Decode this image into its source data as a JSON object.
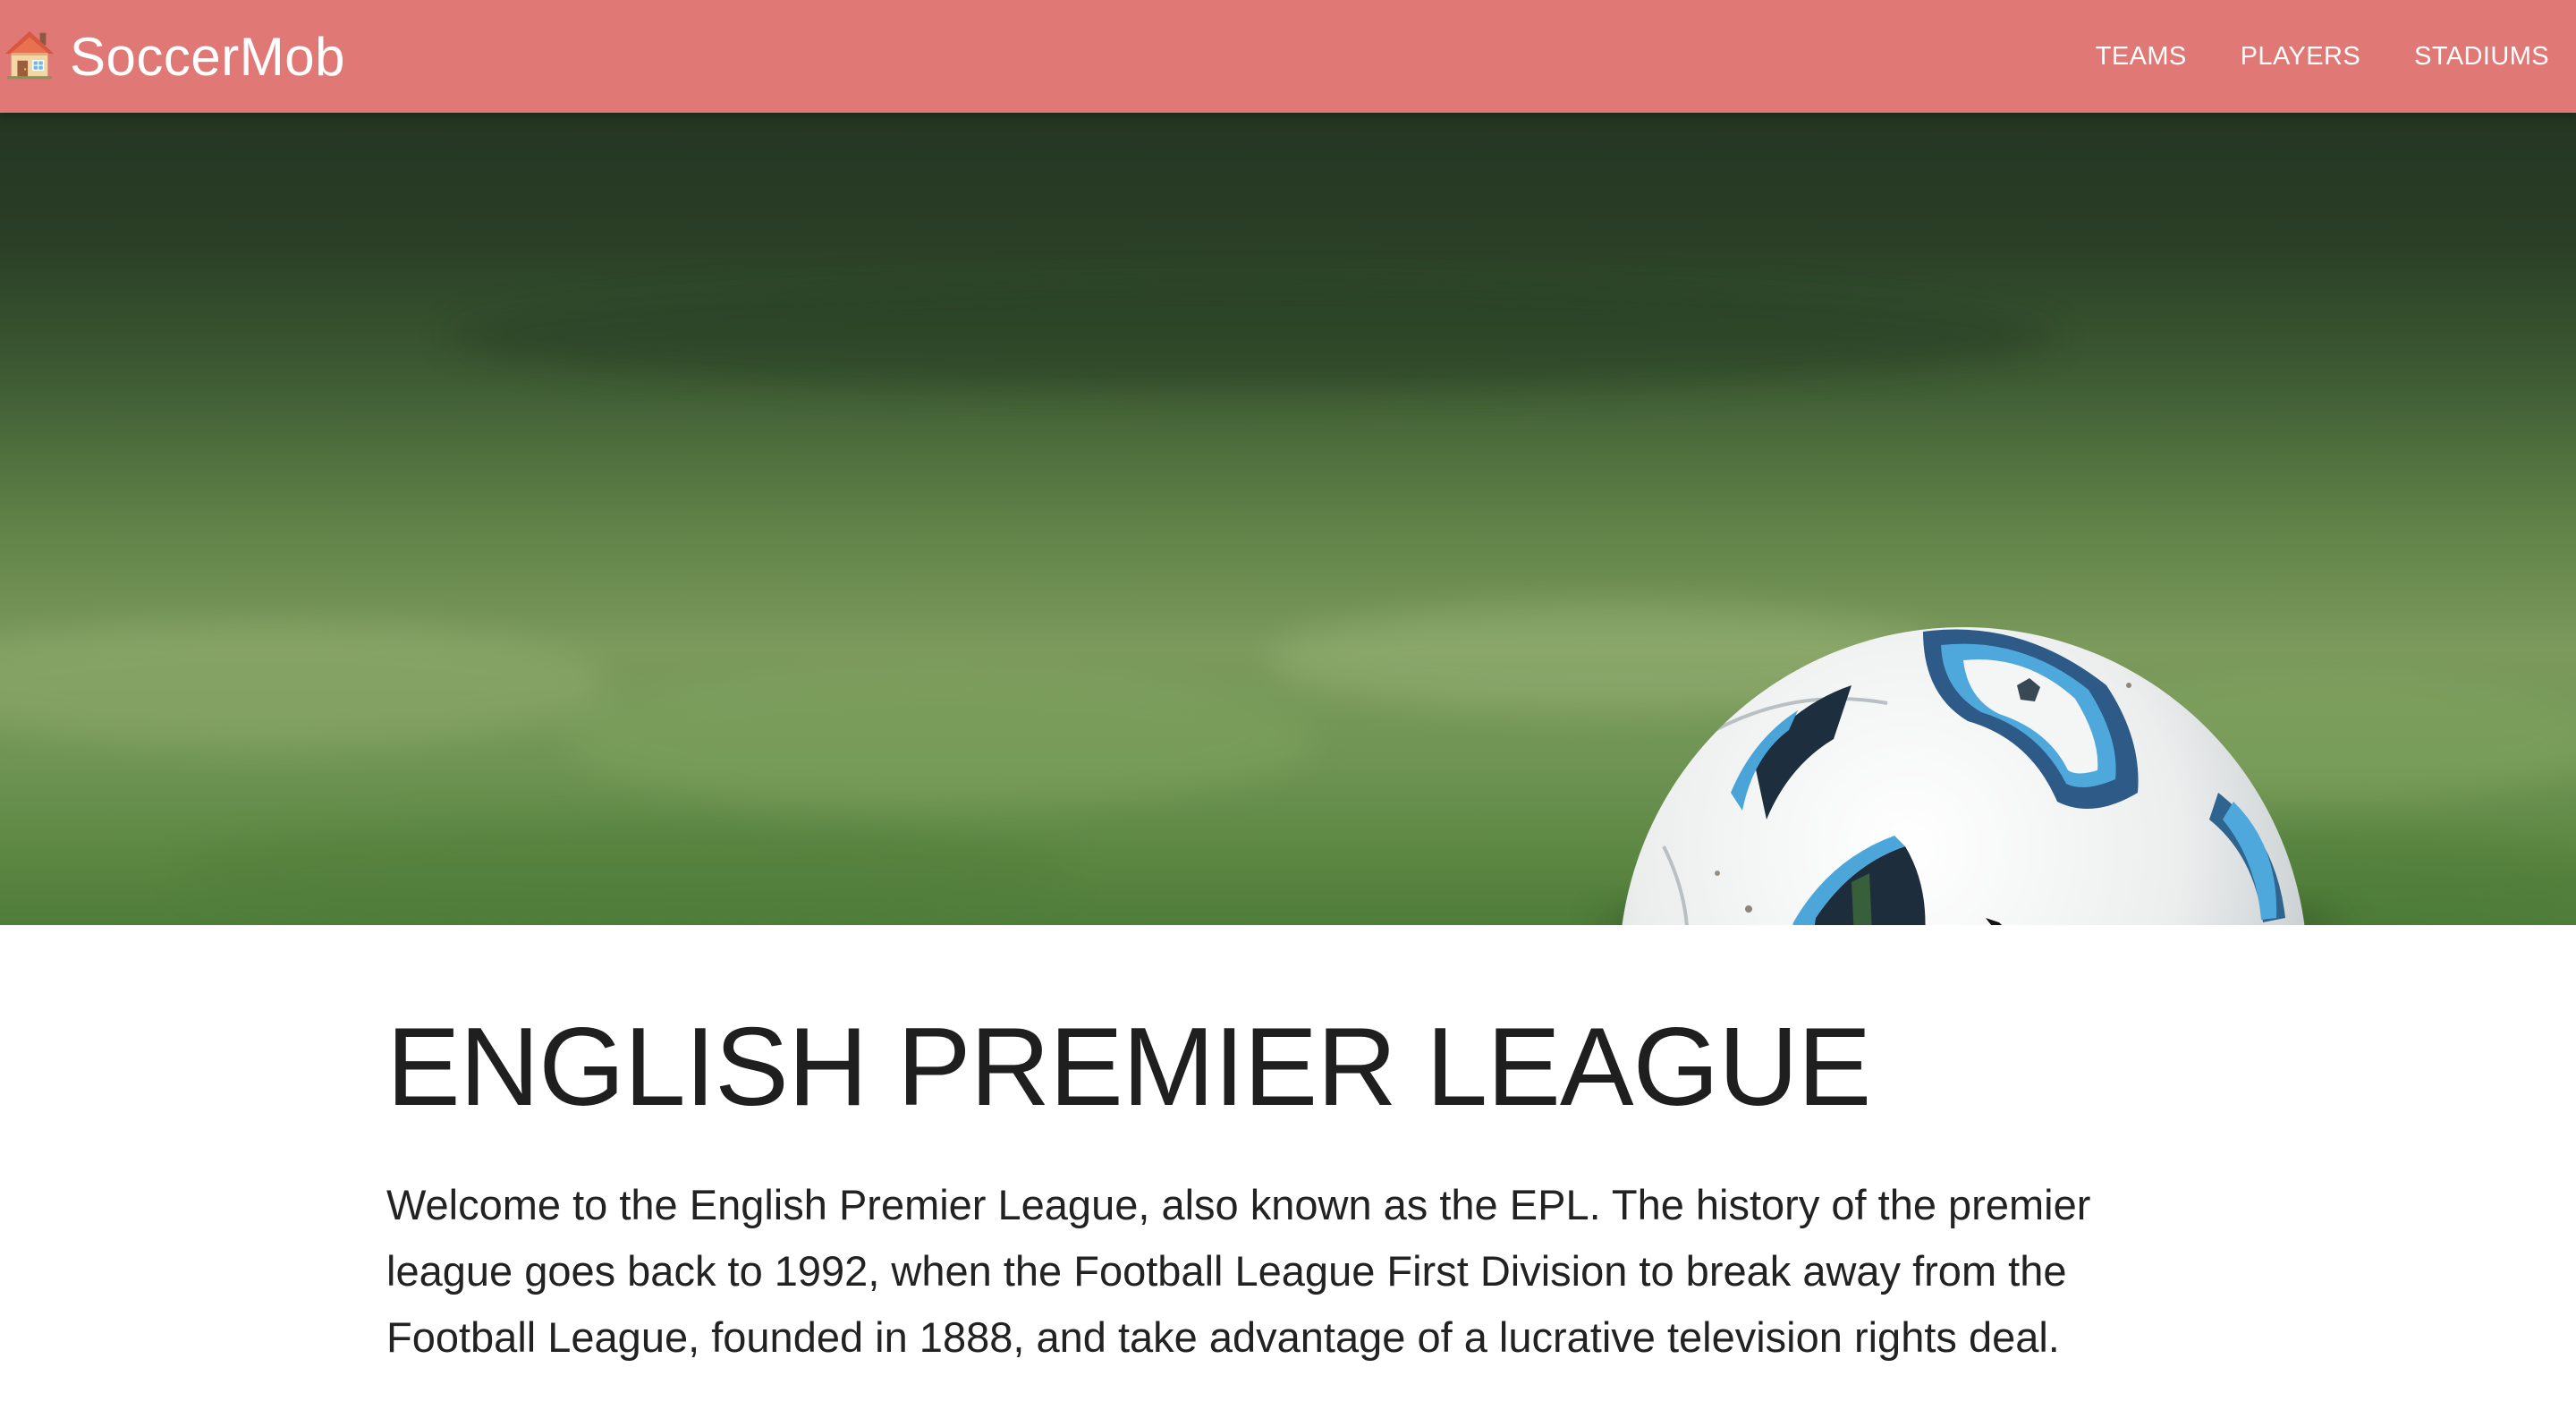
{
  "navbar": {
    "brand_name": "SoccerMob",
    "brand_icon": "house-icon",
    "background_color": "#e07876",
    "links": [
      {
        "label": "TEAMS"
      },
      {
        "label": "PLAYERS"
      },
      {
        "label": "STADIUMS"
      }
    ]
  },
  "hero": {
    "image": "soccer-ball-on-grass-photo"
  },
  "main": {
    "title": "ENGLISH PREMIER LEAGUE",
    "intro": "Welcome to the English Premier League, also known as the EPL. The history of the premier league goes back to 1992, when the Football League First Division to break away from the Football League, founded in 1888, and take advantage of a lucrative television rights deal."
  }
}
